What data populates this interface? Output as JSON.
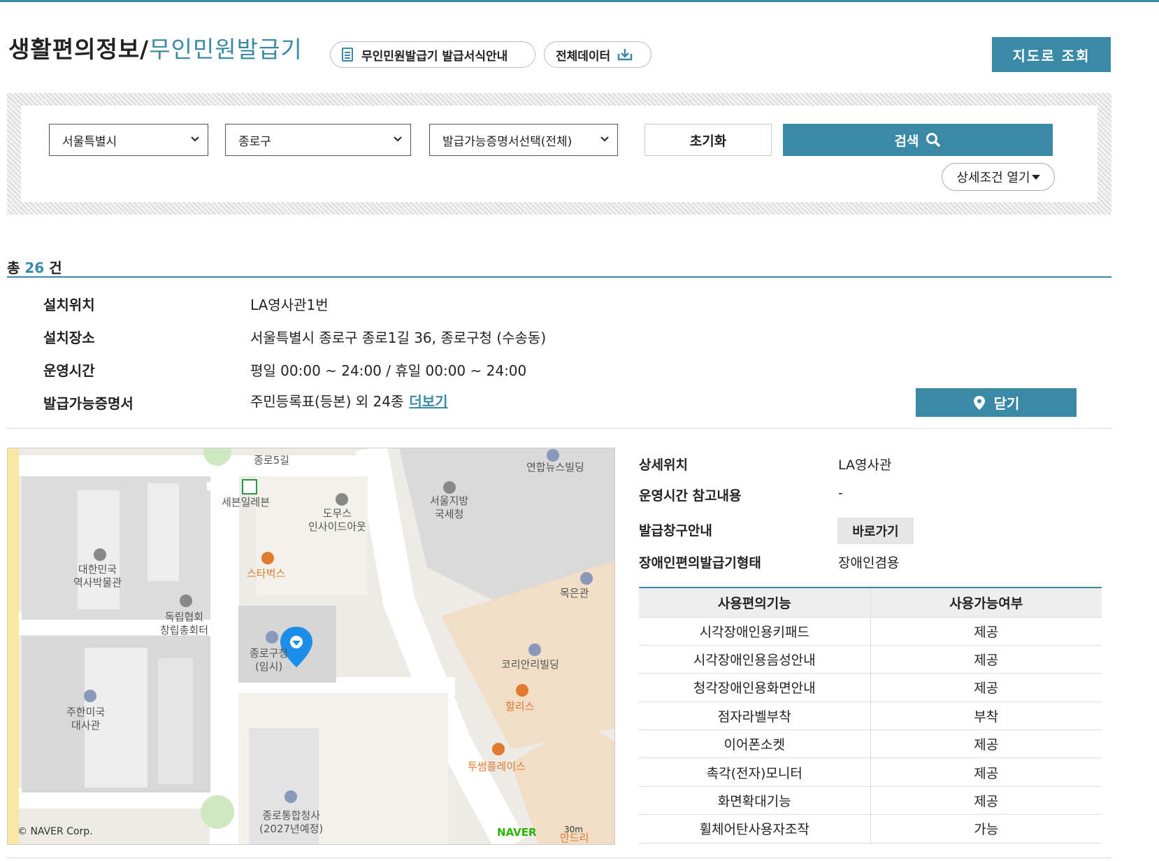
{
  "header": {
    "title_main": "생활편의정보/",
    "title_sub": "무인민원발급기",
    "forms_button": "무인민원발급기 발급서식안내",
    "data_button": "전체데이터",
    "map_button": "지도로 조회"
  },
  "search": {
    "city": "서울특별시",
    "district": "종로구",
    "certificate": "발급가능증명서선택(전체)",
    "reset_label": "초기화",
    "search_label": "검색",
    "detail_label": "상세조건 열기"
  },
  "results": {
    "count_prefix": "총",
    "count": "26",
    "count_suffix": "건"
  },
  "item": {
    "location_label": "설치위치",
    "location_value": "LA영사관1번",
    "place_label": "설치장소",
    "place_value": "서울특별시 종로구 종로1길 36, 종로구청 (수송동)",
    "hours_label": "운영시간",
    "hours_value": "평일 00:00 ~ 24:00 / 휴일 00:00 ~ 24:00",
    "certs_label": "발급가능증명서",
    "certs_value": "주민등록표(등본) 외 24종",
    "more_label": "더보기",
    "close_label": "닫기"
  },
  "map": {
    "labels": {
      "road5": "종로5길",
      "seven": "세븐일레븐",
      "yonhap": "연합뉴스빌딩",
      "nts": "서울지방\n국세청",
      "doms": "도무스\n인사이드아웃",
      "museum": "대한민국\n역사박물관",
      "starbucks": "스타벅스",
      "mokeun": "목은관",
      "indep": "독립협회\n창립총회터",
      "jongno_office": "종로구청\n(임시)",
      "korean_re": "코리안리빌딩",
      "embassy": "주한미국\n대사관",
      "hollys": "할리스",
      "twosome": "투썸플레이스",
      "jongno_gov": "종로통합청사\n(2027년예정)",
      "mandol": "만드리"
    },
    "copyright": "© NAVER Corp.",
    "brand": "NAVER",
    "scale": "30m"
  },
  "detail": {
    "loc_label": "상세위치",
    "loc_value": "LA영사관",
    "hours_note_label": "운영시간 참고내용",
    "hours_note_value": "-",
    "window_label": "발급창구안내",
    "window_button": "바로가기",
    "type_label": "장애인편의발급기형태",
    "type_value": "장애인겸용"
  },
  "features": {
    "headers": [
      "사용편의기능",
      "사용가능여부"
    ],
    "rows": [
      [
        "시각장애인용키패드",
        "제공"
      ],
      [
        "시각장애인용음성안내",
        "제공"
      ],
      [
        "청각장애인용화면안내",
        "제공"
      ],
      [
        "점자라벨부착",
        "부착"
      ],
      [
        "이어폰소켓",
        "제공"
      ],
      [
        "촉각(전자)모니터",
        "제공"
      ],
      [
        "화면확대기능",
        "제공"
      ],
      [
        "휠체어탄사용자조작",
        "가능"
      ]
    ]
  },
  "colors": {
    "accent": "#3a8aa6",
    "naver": "#2db400",
    "orange": "#e07a2e"
  }
}
